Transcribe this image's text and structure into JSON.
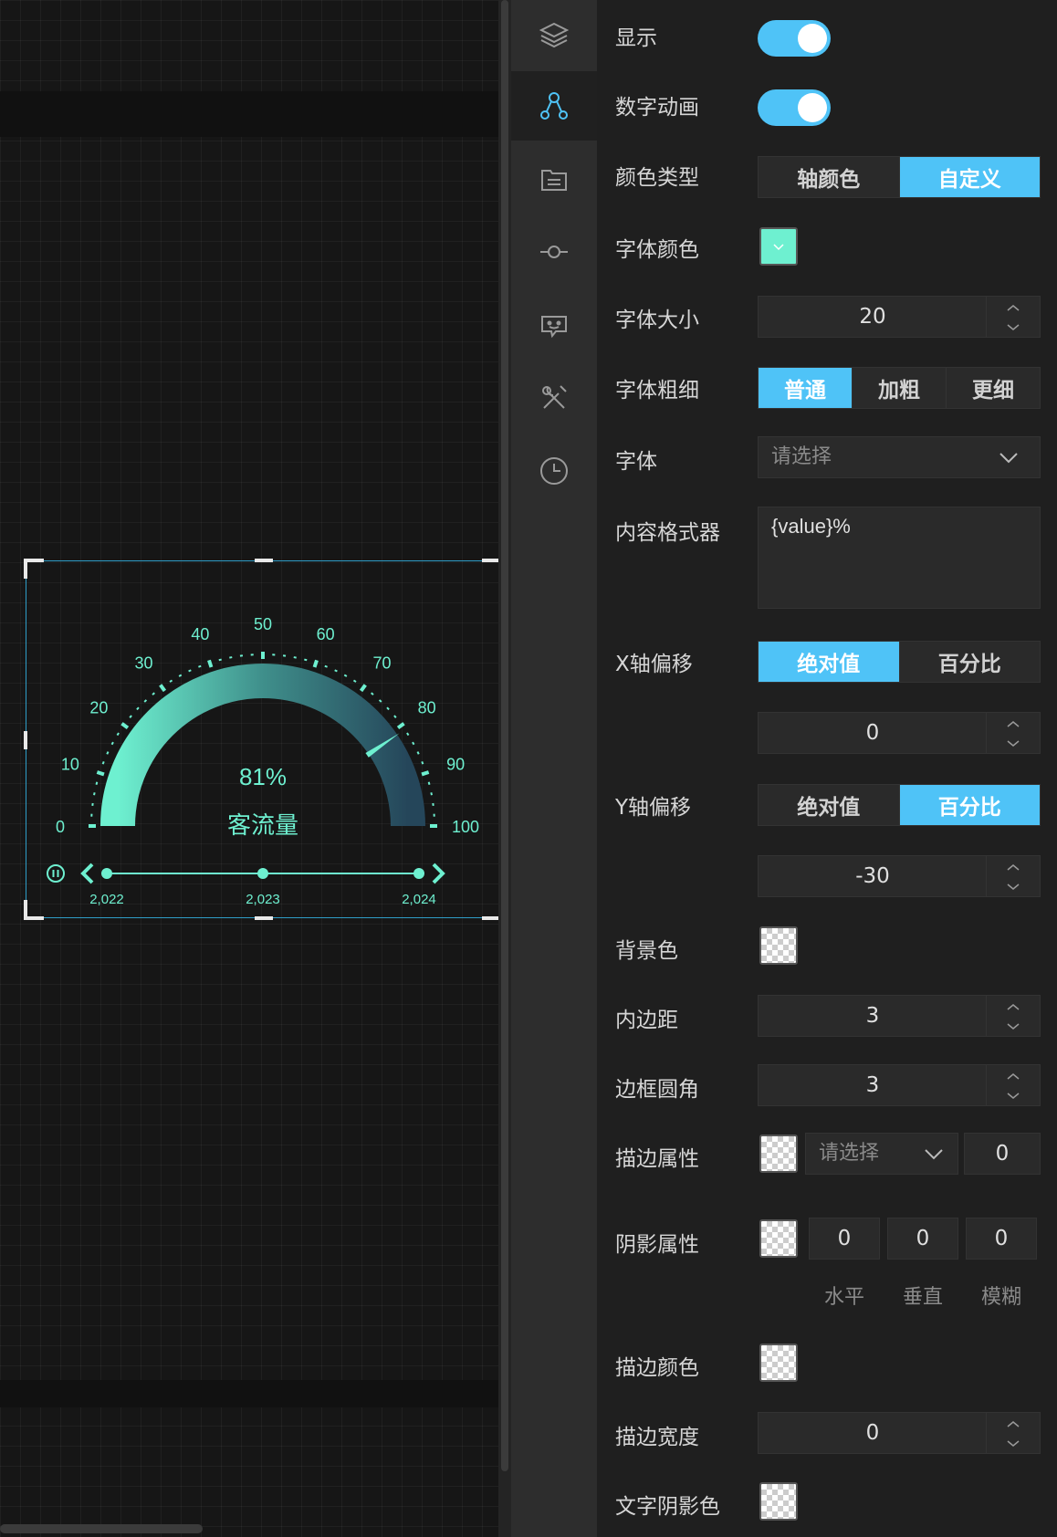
{
  "widget": {
    "value_text": "81%",
    "name": "客流量",
    "value": 81,
    "scale": [
      "0",
      "10",
      "20",
      "30",
      "40",
      "50",
      "60",
      "70",
      "80",
      "90",
      "100"
    ],
    "timeline": [
      "2,022",
      "2,023",
      "2,024"
    ]
  },
  "colors": {
    "accent": "#4fc3f7",
    "gauge": "#6ef0d0"
  },
  "rail_icons": [
    "layers-icon",
    "nodes-icon",
    "list-icon",
    "commit-icon",
    "chat-bot-icon",
    "tools-icon",
    "clock-icon"
  ],
  "settings": {
    "show": "显示",
    "number_anim": "数字动画",
    "color_type": {
      "label": "颜色类型",
      "options": [
        "轴颜色",
        "自定义"
      ],
      "selected": "自定义"
    },
    "font_color": "字体颜色",
    "font_size": {
      "label": "字体大小",
      "value": "20"
    },
    "font_weight": {
      "label": "字体粗细",
      "options": [
        "普通",
        "加粗",
        "更细"
      ],
      "selected": "普通"
    },
    "font": {
      "label": "字体",
      "placeholder": "请选择"
    },
    "formatter": {
      "label": "内容格式器",
      "value": "{value}%"
    },
    "x_offset": {
      "label": "X轴偏移",
      "options": [
        "绝对值",
        "百分比"
      ],
      "selected": "绝对值",
      "value": "0"
    },
    "y_offset": {
      "label": "Y轴偏移",
      "options": [
        "绝对值",
        "百分比"
      ],
      "selected": "百分比",
      "value": "-30"
    },
    "bg_color": "背景色",
    "padding": {
      "label": "内边距",
      "value": "3"
    },
    "radius": {
      "label": "边框圆角",
      "value": "3"
    },
    "border": {
      "label": "描边属性",
      "placeholder": "请选择",
      "value": "0"
    },
    "shadow": {
      "label": "阴影属性",
      "h": "0",
      "v": "0",
      "blur": "0",
      "h_label": "水平",
      "v_label": "垂直",
      "blur_label": "模糊"
    },
    "stroke_color": "描边颜色",
    "stroke_width": {
      "label": "描边宽度",
      "value": "0"
    },
    "text_shadow": "文字阴影色"
  }
}
